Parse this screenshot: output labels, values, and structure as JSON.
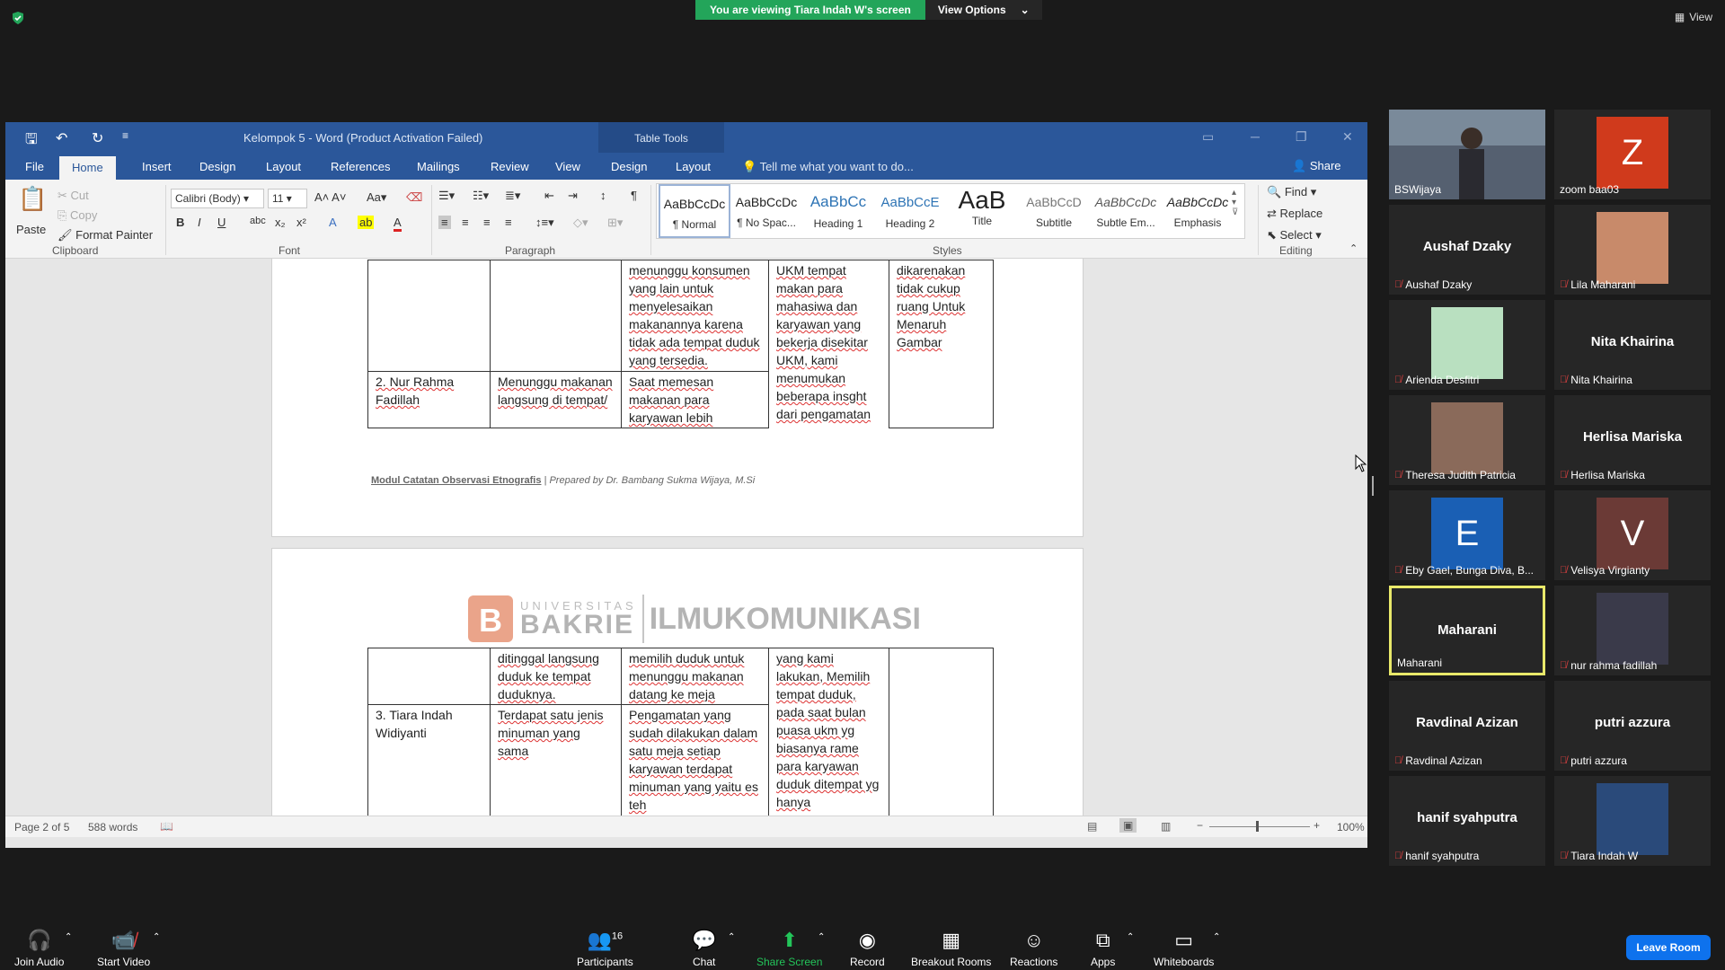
{
  "zoom": {
    "viewing_text": "You are viewing Tiara Indah W's screen",
    "view_options": "View Options",
    "view_label": "View"
  },
  "word": {
    "title": "Kelompok 5 - Word (Product Activation Failed)",
    "table_tools": "Table Tools",
    "tabs": [
      "File",
      "Home",
      "Insert",
      "Design",
      "Layout",
      "References",
      "Mailings",
      "Review",
      "View",
      "Design",
      "Layout"
    ],
    "tell_me": "Tell me what you want to do...",
    "share": "Share",
    "clipboard": {
      "paste": "Paste",
      "cut": "Cut",
      "copy": "Copy",
      "format_painter": "Format Painter",
      "group": "Clipboard"
    },
    "font": {
      "name": "Calibri (Body)",
      "size": "11",
      "group": "Font"
    },
    "paragraph_group": "Paragraph",
    "styles_group": "Styles",
    "editing": {
      "find": "Find",
      "replace": "Replace",
      "select": "Select",
      "group": "Editing"
    },
    "styles": [
      {
        "preview": "AaBbCcDc",
        "name": "¶ Normal"
      },
      {
        "preview": "AaBbCcDc",
        "name": "¶ No Spac..."
      },
      {
        "preview": "AaBbCc",
        "name": "Heading 1"
      },
      {
        "preview": "AaBbCcE",
        "name": "Heading 2"
      },
      {
        "preview": "AaB",
        "name": "Title"
      },
      {
        "preview": "AaBbCcD",
        "name": "Subtitle"
      },
      {
        "preview": "AaBbCcDc",
        "name": "Subtle Em..."
      },
      {
        "preview": "AaBbCcDc",
        "name": "Emphasis"
      }
    ],
    "page1": {
      "row0": [
        "",
        "",
        "menunggu konsumen yang lain untuk menyelesaikan makanannya karena tidak ada tempat duduk yang tersedia.",
        "UKM tempat makan para mahasiwa dan karyawan yang bekerja disekitar UKM, kami menumukan beberapa insght dari pengamatan",
        "dikarenakan tidak cukup ruang Untuk Menaruh Gambar"
      ],
      "row1": [
        "2. Nur Rahma Fadillah",
        "Menunggu makanan langsung di tempat/",
        "Saat memesan makanan para karyawan lebih"
      ],
      "footer_title": "Modul Catatan Observasi Etnografis",
      "footer_by": "| Prepared by Dr. Bambang Sukma Wijaya, M.Si"
    },
    "page2": {
      "logo_top": "UNIVERSITAS",
      "logo_main": "BAKRIE",
      "logo_right": "ILMUKOMUNIKASI",
      "row0": [
        "",
        "ditinggal langsung duduk ke tempat duduknya.",
        "memilih duduk untuk menunggu makanan datang ke meja",
        "yang kami lakukan, Memilih tempat duduk, pada saat bulan puasa ukm yg biasanya rame para karyawan duduk ditempat yg hanya",
        ""
      ],
      "row1": [
        "3. Tiara Indah Widiyanti",
        "Terdapat satu jenis minuman yang sama",
        "Pengamatan yang sudah dilakukan dalam satu meja setiap karyawan terdapat minuman yang yaitu es teh"
      ]
    },
    "status": {
      "page": "Page 2 of 5",
      "words": "588 words",
      "zoom": "100%"
    }
  },
  "participants": [
    {
      "name": "BSWijaya",
      "type": "video",
      "color": "#5a6a7a"
    },
    {
      "name": "zoom baa03",
      "type": "letter",
      "letter": "Z",
      "color": "#d03a1c"
    },
    {
      "name": "Aushaf Dzaky",
      "type": "name",
      "muted": true
    },
    {
      "name": "Lila Maharani",
      "type": "photo",
      "muted": true,
      "color": "#c88a6a"
    },
    {
      "name": "Arienda Desfitri",
      "type": "photo",
      "muted": true,
      "color": "#b9e0c0"
    },
    {
      "name": "Nita Khairina",
      "type": "name",
      "muted": true
    },
    {
      "name": "Theresa Judith Patricia",
      "type": "photo",
      "muted": true,
      "color": "#8a6a5a"
    },
    {
      "name": "Herlisa Mariska",
      "type": "name",
      "muted": true
    },
    {
      "name": "Eby Gael, Bunga Diva, B...",
      "type": "letter",
      "letter": "E",
      "muted": true,
      "color": "#1a5fb4"
    },
    {
      "name": "Velisya Virgianty",
      "type": "letter",
      "letter": "V",
      "muted": true,
      "color": "#6b3a36"
    },
    {
      "name": "Maharani",
      "type": "name",
      "muted": false,
      "active": true
    },
    {
      "name": "nur rahma fadillah",
      "type": "photo",
      "muted": true,
      "color": "#3a3a4a"
    },
    {
      "name": "Ravdinal Azizan",
      "type": "name",
      "muted": true
    },
    {
      "name": "putri azzura",
      "type": "name",
      "muted": true
    },
    {
      "name": "hanif syahputra",
      "type": "name",
      "muted": true
    },
    {
      "name": "Tiara Indah W",
      "type": "photo",
      "muted": true,
      "color": "#2a4a7a"
    }
  ],
  "toolbar": {
    "join_audio": "Join Audio",
    "start_video": "Start Video",
    "participants": "Participants",
    "participants_count": "16",
    "chat": "Chat",
    "share_screen": "Share Screen",
    "record": "Record",
    "breakout": "Breakout Rooms",
    "reactions": "Reactions",
    "apps": "Apps",
    "whiteboards": "Whiteboards",
    "leave": "Leave Room"
  },
  "colors": {
    "word_blue": "#2b579a",
    "zoom_green": "#23a55a",
    "leave_blue": "#0e72ed",
    "active_border": "#e8e86a"
  }
}
